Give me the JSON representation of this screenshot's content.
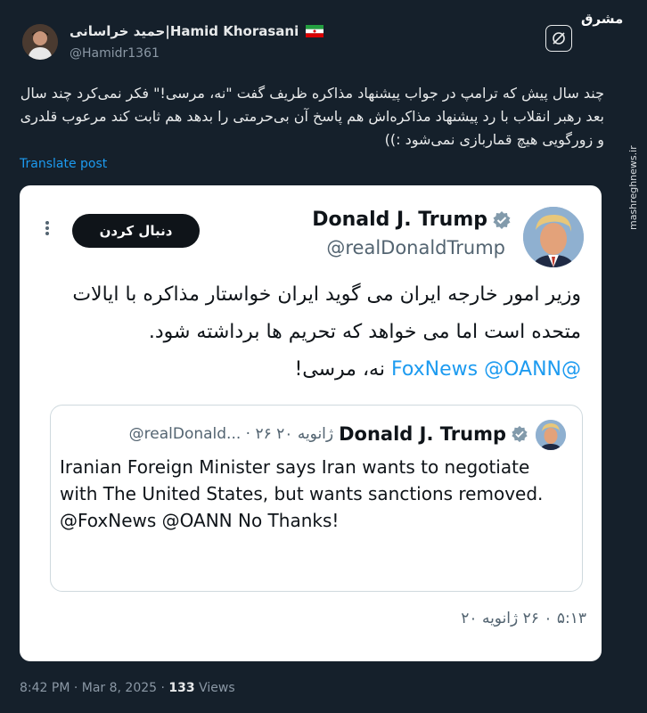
{
  "author": {
    "display_name": "حمید خراسانی|Hamid Khorasani",
    "handle": "@Hamidr1361"
  },
  "watermark": {
    "logo": "مشرق",
    "url": "mashreghnews.ir"
  },
  "tweet": {
    "text": "چند سال پیش که ترامپ در جواب پیشنهاد مذاکره ظریف گفت \"نه، مرسی!\" فکر نمی‌کرد چند سال بعد رهبر انقلاب با رد پیشنهاد مذاکره‌اش هم پاسخ آن بی‌حرمتی را بدهد هم ثابت کند مرعوب قلدری و زورگویی هیچ قماربازی نمی‌شود :))",
    "translate_label": "Translate post"
  },
  "card": {
    "name": "Donald J. Trump",
    "handle": "@realDonaldTrump",
    "follow_label": "دنبال کردن",
    "text_main": "وزیر امور خارجه ایران می گوید ایران خواستار مذاکره با ایالات متحده است اما می خواهد که تحریم ها برداشته شود.",
    "text_links": "@FoxNews @OANN",
    "text_end": "نه، مرسی!",
    "time": "۵:۱۳ ۰ ۲۶ ژانویه ۲۰",
    "quote": {
      "name": "Donald J. Trump",
      "meta": "@realDonald... · ۲۶ ژانویه ۲۰",
      "text": "Iranian Foreign Minister says Iran wants to negotiate with The United States, but wants sanctions removed. @FoxNews  @OANN No Thanks!"
    }
  },
  "footer": {
    "time": "8:42 PM · Mar 8, 2025 · ",
    "views_count": "133",
    "views_label": " Views"
  },
  "colors": {
    "background": "#15202b",
    "link": "#1d9bf0",
    "verified": "#829aab"
  }
}
